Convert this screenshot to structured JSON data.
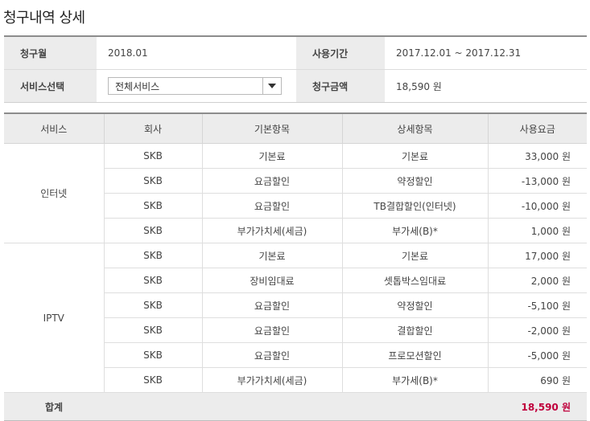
{
  "page": {
    "title": "청구내역 상세"
  },
  "info": {
    "billing_month_label": "청구월",
    "billing_month_value": "2018.01",
    "usage_period_label": "사용기간",
    "usage_period_value": "2017.12.01 ~ 2017.12.31",
    "service_select_label": "서비스선택",
    "service_select_value": "전체서비스",
    "billing_amount_label": "청구금액",
    "billing_amount_value": "18,590 원"
  },
  "table": {
    "headers": [
      "서비스",
      "회사",
      "기본항목",
      "상세항목",
      "사용요금"
    ],
    "groups": [
      {
        "service": "인터넷",
        "rows": [
          {
            "company": "SKB",
            "basic": "기본료",
            "detail": "기본료",
            "fee": "33,000 원"
          },
          {
            "company": "SKB",
            "basic": "요금할인",
            "detail": "약정할인",
            "fee": "-13,000 원"
          },
          {
            "company": "SKB",
            "basic": "요금할인",
            "detail": "TB결합할인(인터넷)",
            "fee": "-10,000 원"
          },
          {
            "company": "SKB",
            "basic": "부가가치세(세금)",
            "detail": "부가세(B)*",
            "fee": "1,000 원"
          }
        ]
      },
      {
        "service": "IPTV",
        "rows": [
          {
            "company": "SKB",
            "basic": "기본료",
            "detail": "기본료",
            "fee": "17,000 원"
          },
          {
            "company": "SKB",
            "basic": "장비임대료",
            "detail": "셋톱박스임대료",
            "fee": "2,000 원"
          },
          {
            "company": "SKB",
            "basic": "요금할인",
            "detail": "약정할인",
            "fee": "-5,100 원"
          },
          {
            "company": "SKB",
            "basic": "요금할인",
            "detail": "결합할인",
            "fee": "-2,000 원"
          },
          {
            "company": "SKB",
            "basic": "요금할인",
            "detail": "프로모션할인",
            "fee": "-5,000 원"
          },
          {
            "company": "SKB",
            "basic": "부가가치세(세금)",
            "detail": "부가세(B)*",
            "fee": "690 원"
          }
        ]
      }
    ],
    "total_label": "합계",
    "total_value": "18,590 원"
  },
  "colors": {
    "accent_total": "#c0003c",
    "header_bg": "#ececec"
  },
  "icons": {
    "select_arrow": "caret-down-icon"
  }
}
